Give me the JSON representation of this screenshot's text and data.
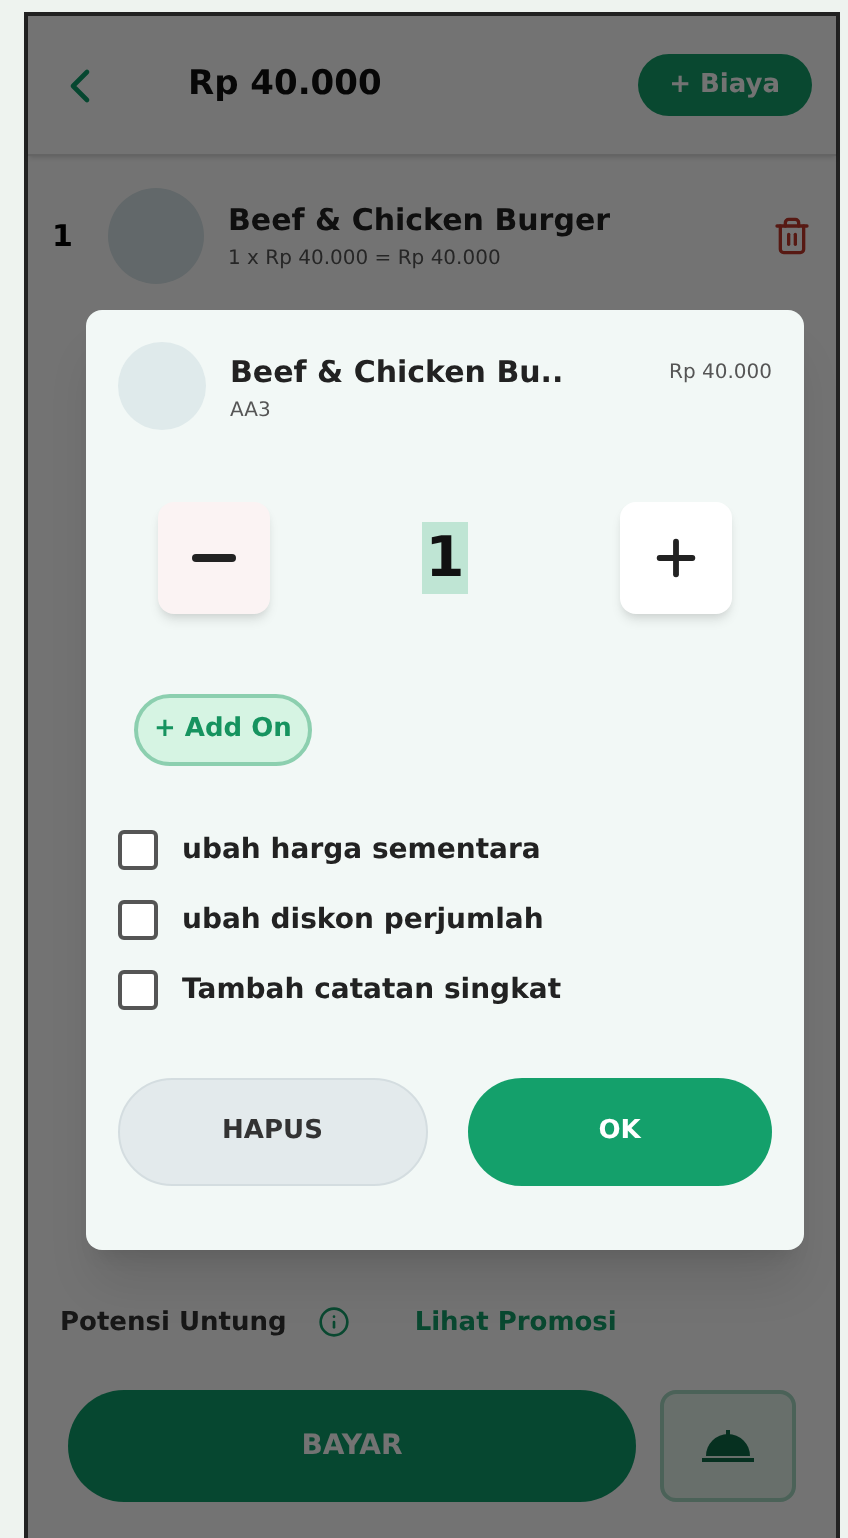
{
  "header": {
    "title": "Rp 40.000",
    "add_button": "+ Biaya"
  },
  "items": [
    {
      "number": "1",
      "name": "Beef & Chicken Burger",
      "detail": "1 x Rp 40.000 = Rp 40.000"
    }
  ],
  "dialog": {
    "name": "Beef & Chicken Bu..",
    "code": "AA3",
    "price": "Rp 40.000",
    "quantity": "1",
    "add_on": "+ Add On",
    "options": [
      {
        "label": "ubah harga sementara",
        "checked": false
      },
      {
        "label": "ubah diskon perjumlah",
        "checked": false
      },
      {
        "label": "Tambah catatan singkat",
        "checked": false
      }
    ],
    "buttons": [
      {
        "label": "HAPUS",
        "kind": "secondary"
      },
      {
        "label": "OK",
        "kind": "primary"
      }
    ]
  },
  "footer": {
    "profit_label": "Potensi Untung",
    "promo_link": "Lihat Promosi",
    "pay_button": "BAYAR"
  }
}
